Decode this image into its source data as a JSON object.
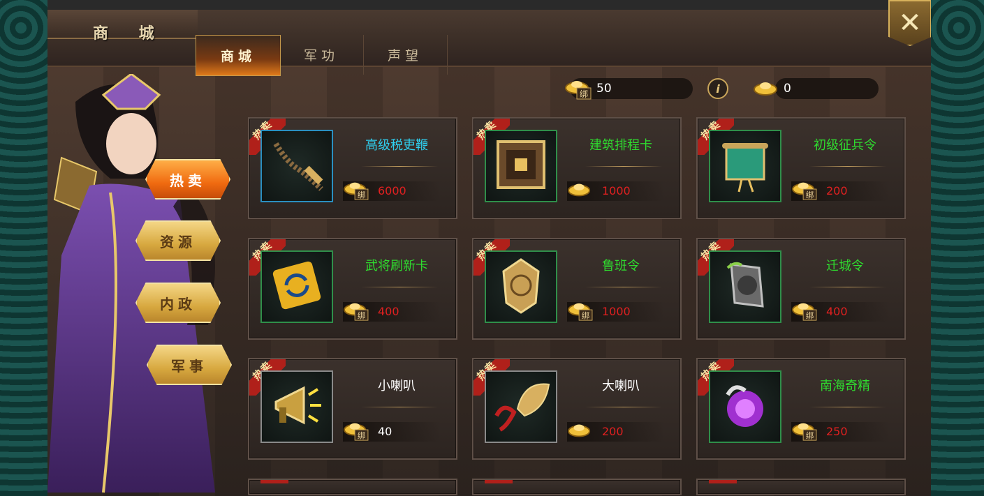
{
  "window": {
    "title": "商 城",
    "close_glyph": "✕"
  },
  "tabs": [
    {
      "label": "商城",
      "active": true
    },
    {
      "label": "军功",
      "active": false
    },
    {
      "label": "声望",
      "active": false
    }
  ],
  "categories": [
    {
      "label": "热卖",
      "active": true
    },
    {
      "label": "资源",
      "active": false
    },
    {
      "label": "内政",
      "active": false
    },
    {
      "label": "军事",
      "active": false
    }
  ],
  "currency": {
    "bound_gold": "50",
    "gold": "0",
    "info": "i"
  },
  "hot_tag": "热卖",
  "coin_bound_label": "绑",
  "items": [
    {
      "name": "高级税吏鞭",
      "name_color": "#2fd0f0",
      "price": "6000",
      "price_color": "#e02020",
      "currency": "bound",
      "icon": "whip-icon",
      "frame": "blue"
    },
    {
      "name": "建筑排程卡",
      "name_color": "#2fdc2f",
      "price": "1000",
      "price_color": "#e02020",
      "currency": "gold",
      "icon": "schedule-card-icon",
      "frame": "green"
    },
    {
      "name": "初级征兵令",
      "name_color": "#2fdc2f",
      "price": "200",
      "price_color": "#e02020",
      "currency": "bound",
      "icon": "scroll-icon",
      "frame": "green"
    },
    {
      "name": "武将刷新卡",
      "name_color": "#2fdc2f",
      "price": "400",
      "price_color": "#e02020",
      "currency": "bound",
      "icon": "refresh-card-icon",
      "frame": "green"
    },
    {
      "name": "鲁班令",
      "name_color": "#2fdc2f",
      "price": "1000",
      "price_color": "#e02020",
      "currency": "bound",
      "icon": "token-icon",
      "frame": "green"
    },
    {
      "name": "迁城令",
      "name_color": "#2fdc2f",
      "price": "400",
      "price_color": "#e02020",
      "currency": "bound",
      "icon": "relocate-token-icon",
      "frame": "green"
    },
    {
      "name": "小喇叭",
      "name_color": "#ffffff",
      "price": "40",
      "price_color": "#ffffff",
      "currency": "bound",
      "icon": "megaphone-icon",
      "frame": "gray"
    },
    {
      "name": "大喇叭",
      "name_color": "#ffffff",
      "price": "200",
      "price_color": "#e02020",
      "currency": "gold",
      "icon": "gramophone-icon",
      "frame": "gray"
    },
    {
      "name": "南海奇精",
      "name_color": "#2fdc2f",
      "price": "250",
      "price_color": "#e02020",
      "currency": "bound",
      "icon": "spirit-icon",
      "frame": "green"
    }
  ]
}
